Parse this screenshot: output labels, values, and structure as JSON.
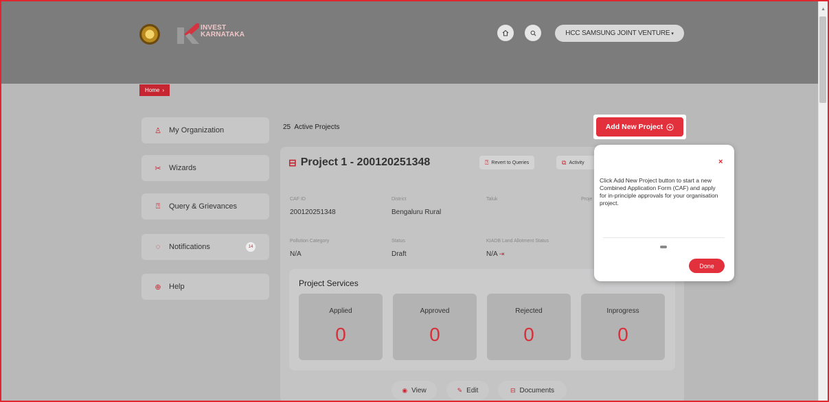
{
  "brand": {
    "logo_line1": "INVEST",
    "logo_line2": "KARNATAKA",
    "accent": "#e2313c"
  },
  "header": {
    "home_icon": "home-icon",
    "search_icon": "search-icon",
    "user_name": "HCC SAMSUNG JOINT VENTURE",
    "user_caret": "▾"
  },
  "breadcrumb": {
    "label": "Home",
    "separator": "›"
  },
  "sidebar": {
    "items": [
      {
        "label": "My Organization",
        "icon": "user-icon"
      },
      {
        "label": "Wizards",
        "icon": "wand-icon"
      },
      {
        "label": "Query & Grievances",
        "icon": "question-icon"
      },
      {
        "label": "Notifications",
        "icon": "bell-icon",
        "badge": "14"
      },
      {
        "label": "Help",
        "icon": "lifebuoy-icon"
      }
    ]
  },
  "main": {
    "active_count": "25",
    "active_label": "Active Projects",
    "add_button": "Add New Project",
    "project": {
      "title": "Project 1 - 200120251348",
      "revert_label": "Revert to Queries",
      "activity_label": "Activity",
      "fields": {
        "caf_label": "CAF ID",
        "caf_value": "200120251348",
        "district_label": "District",
        "district_value": "Bengaluru Rural",
        "taluk_label": "Taluk",
        "taluk_value": "",
        "proj_label": "Proje",
        "pollution_label": "Pollution Category",
        "pollution_value": "N/A",
        "status_label": "Status",
        "status_value": "Draft",
        "kiadb_label": "KIADB Land Allotment Status",
        "kiadb_value": "N/A"
      },
      "services": {
        "title": "Project Services",
        "applied_label": "Applied",
        "applied_value": "0",
        "approved_label": "Approved",
        "approved_value": "0",
        "rejected_label": "Rejected",
        "rejected_value": "0",
        "inprogress_label": "Inprogress",
        "inprogress_value": "0"
      },
      "actions": {
        "view": "View",
        "edit": "Edit",
        "documents": "Documents"
      }
    }
  },
  "tooltip": {
    "close": "×",
    "text": "Click Add New Project button to start a new Combined Application Form (CAF) and apply for in-principle approvals for your organisation project.",
    "done": "Done"
  }
}
